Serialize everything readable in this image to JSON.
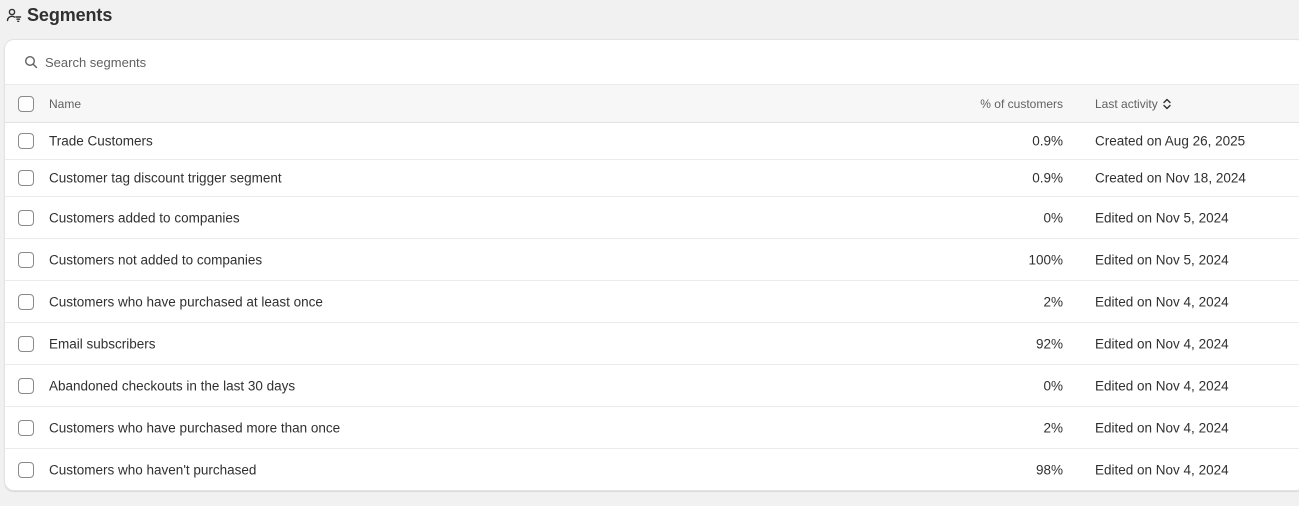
{
  "header": {
    "title": "Segments",
    "icon": "customer-segment-icon"
  },
  "search": {
    "placeholder": "Search segments",
    "value": ""
  },
  "table": {
    "columns": {
      "name": "Name",
      "percent": "% of customers",
      "last_activity": "Last activity"
    },
    "rows": [
      {
        "name": "Trade Customers",
        "percent": "0.9%",
        "activity": "Created on Aug 26, 2025"
      },
      {
        "name": "Customer tag discount trigger segment",
        "percent": "0.9%",
        "activity": "Created on Nov 18, 2024"
      },
      {
        "name": "Customers added to companies",
        "percent": "0%",
        "activity": "Edited on Nov 5, 2024"
      },
      {
        "name": "Customers not added to companies",
        "percent": "100%",
        "activity": "Edited on Nov 5, 2024"
      },
      {
        "name": "Customers who have purchased at least once",
        "percent": "2%",
        "activity": "Edited on Nov 4, 2024"
      },
      {
        "name": "Email subscribers",
        "percent": "92%",
        "activity": "Edited on Nov 4, 2024"
      },
      {
        "name": "Abandoned checkouts in the last 30 days",
        "percent": "0%",
        "activity": "Edited on Nov 4, 2024"
      },
      {
        "name": "Customers who have purchased more than once",
        "percent": "2%",
        "activity": "Edited on Nov 4, 2024"
      },
      {
        "name": "Customers who haven't purchased",
        "percent": "98%",
        "activity": "Edited on Nov 4, 2024"
      }
    ]
  }
}
